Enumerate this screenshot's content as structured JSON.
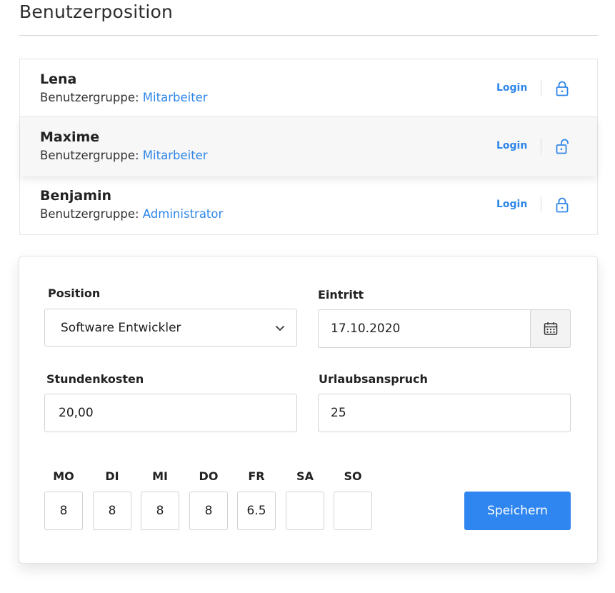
{
  "page": {
    "title": "Benutzerposition"
  },
  "users": [
    {
      "name": "Lena",
      "group_label": "Benutzergruppe:",
      "group": "Mitarbeiter",
      "login": "Login",
      "lock_icon": "lock-closed-icon"
    },
    {
      "name": "Maxime",
      "group_label": "Benutzergruppe:",
      "group": "Mitarbeiter",
      "login": "Login",
      "lock_icon": "lock-open-icon"
    },
    {
      "name": "Benjamin",
      "group_label": "Benutzergruppe:",
      "group": "Administrator",
      "login": "Login",
      "lock_icon": "lock-closed-icon"
    }
  ],
  "form": {
    "position_label": "Position",
    "position_value": "Software Entwickler",
    "entry_label": "Eintritt",
    "entry_value": "17.10.2020",
    "hourly_label": "Stundenkosten",
    "hourly_value": "20,00",
    "vacation_label": "Urlaubsanspruch",
    "vacation_value": "25",
    "days": [
      {
        "label": "MO",
        "value": "8"
      },
      {
        "label": "DI",
        "value": "8"
      },
      {
        "label": "MI",
        "value": "8"
      },
      {
        "label": "DO",
        "value": "8"
      },
      {
        "label": "FR",
        "value": "6.5"
      },
      {
        "label": "SA",
        "value": ""
      },
      {
        "label": "SO",
        "value": ""
      }
    ],
    "save_label": "Speichern"
  },
  "colors": {
    "accent": "#2f86e8",
    "button": "#2f86f0"
  }
}
